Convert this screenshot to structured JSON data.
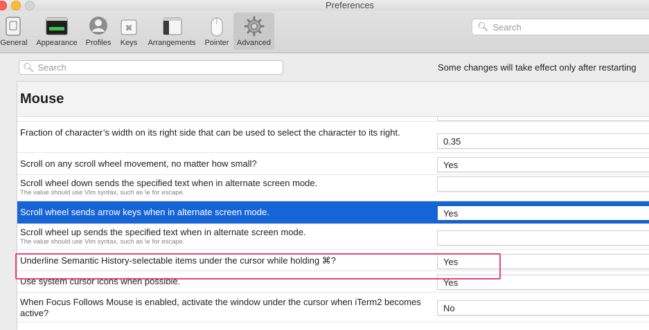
{
  "window": {
    "title": "Preferences"
  },
  "toolbar": {
    "items": [
      {
        "label": "General",
        "icon": "general-icon"
      },
      {
        "label": "Appearance",
        "icon": "appearance-icon"
      },
      {
        "label": "Profiles",
        "icon": "profiles-icon"
      },
      {
        "label": "Keys",
        "icon": "keys-icon"
      },
      {
        "label": "Arrangements",
        "icon": "arrangements-icon"
      },
      {
        "label": "Pointer",
        "icon": "pointer-icon"
      },
      {
        "label": "Advanced",
        "icon": "gear-icon"
      }
    ],
    "search_placeholder": "Search"
  },
  "advanced": {
    "search_placeholder": "Search",
    "notice": "Some changes will take effect only after restarting",
    "section_title": "Mouse",
    "cut_row_value": "No",
    "rows": [
      {
        "label": "Fraction of character’s width on its right side that can be used to select the character to its right.",
        "hint": "",
        "value": "0.35"
      },
      {
        "label": "Scroll on any scroll wheel movement, no matter how small?",
        "hint": "",
        "value": "Yes"
      },
      {
        "label": "Scroll wheel down sends the specified text when in alternate screen mode.",
        "hint": "The value should use Vim syntax, such as \\e for escape.",
        "value": ""
      },
      {
        "label": "Scroll wheel sends arrow keys when in alternate screen mode.",
        "hint": "",
        "value": "Yes"
      },
      {
        "label": "Scroll wheel up sends the specified text when in alternate screen mode.",
        "hint": "The value should use Vim syntax, such as \\e for escape.",
        "value": ""
      },
      {
        "label": "Underline Semantic History-selectable items under the cursor while holding ⌘?",
        "hint": "",
        "value": "Yes"
      },
      {
        "label": "Use system cursor icons when possible.",
        "hint": "",
        "value": "Yes"
      },
      {
        "label": "When Focus Follows Mouse is enabled, activate the window under the cursor when iTerm2 becomes active?",
        "hint": "",
        "value": "No"
      }
    ]
  },
  "colors": {
    "selection": "#1565d6",
    "highlight_outline": "#e8457a"
  }
}
